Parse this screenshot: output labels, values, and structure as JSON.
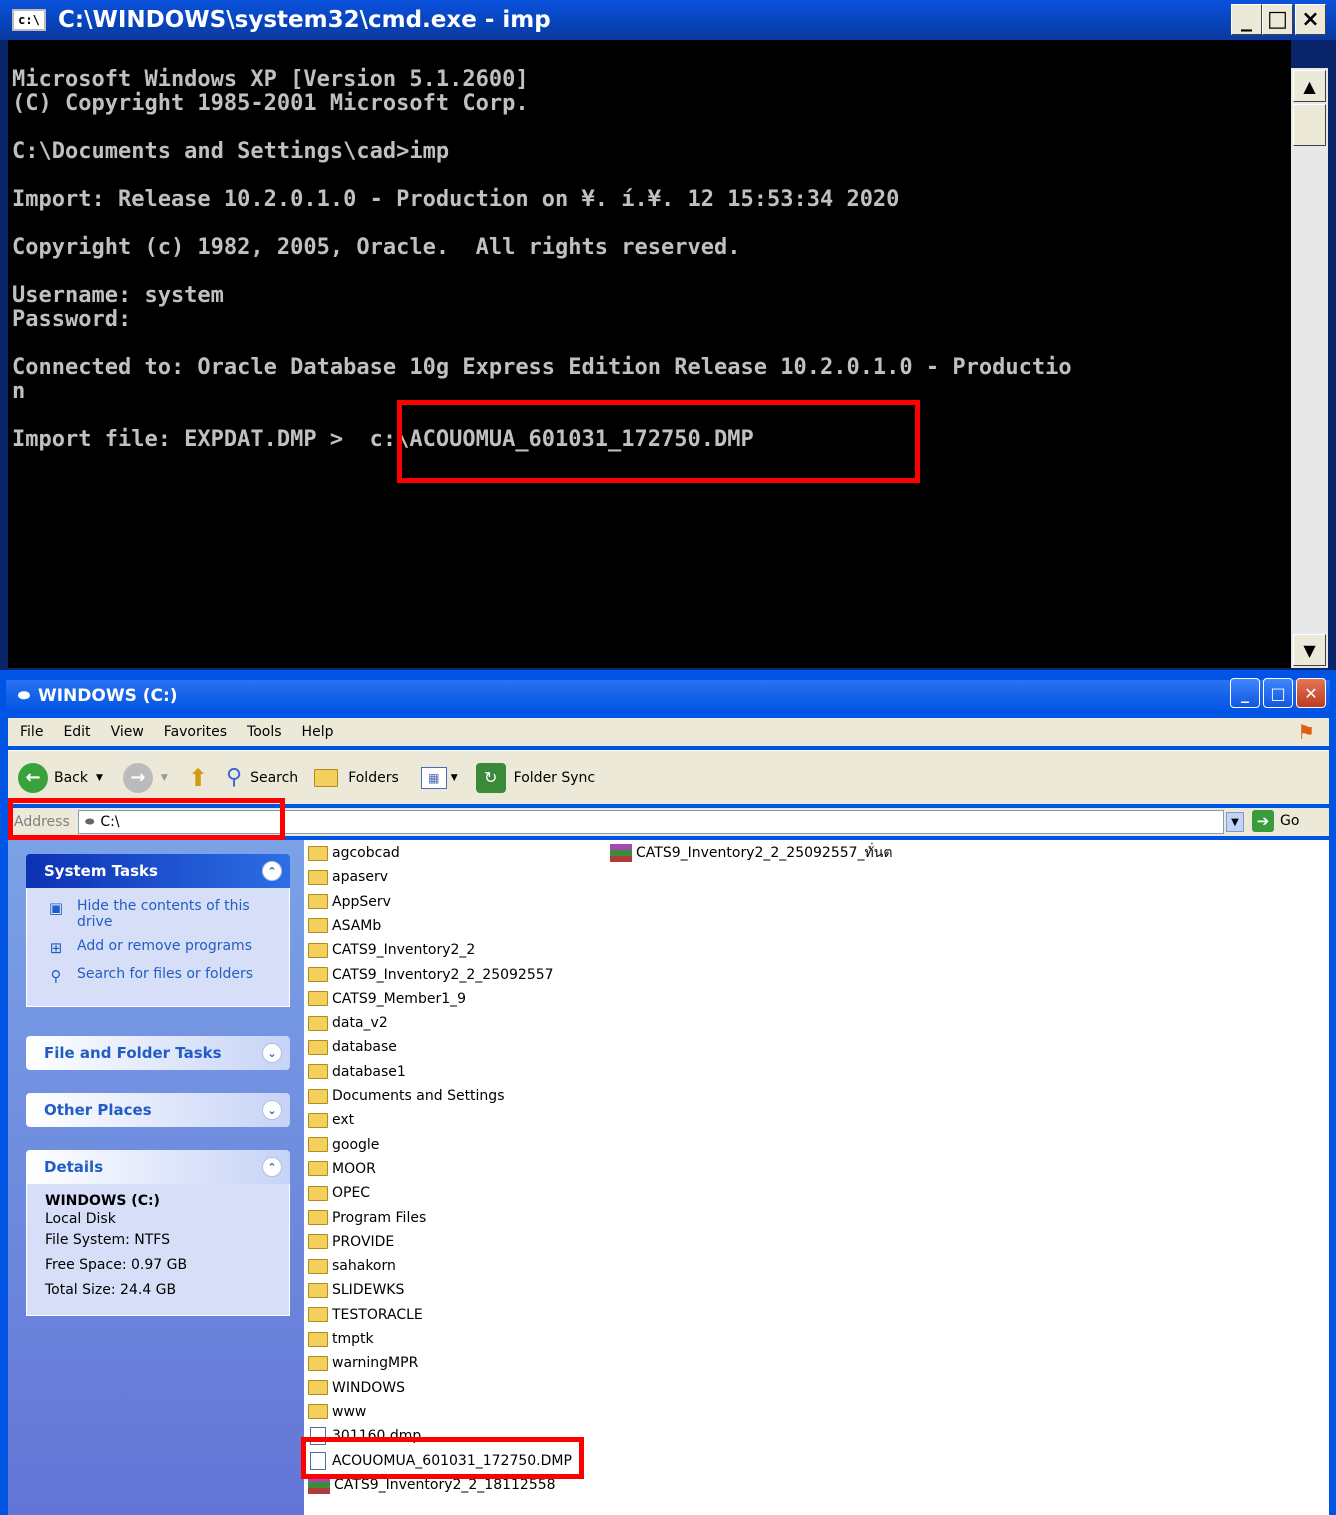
{
  "cmd": {
    "title": "C:\\WINDOWS\\system32\\cmd.exe - imp",
    "icon_text": "c:\\",
    "lines": [
      "Microsoft Windows XP [Version 5.1.2600]",
      "(C) Copyright 1985-2001 Microsoft Corp.",
      "",
      "C:\\Documents and Settings\\cad>imp",
      "",
      "Import: Release 10.2.0.1.0 - Production on ¥. í.¥. 12 15:53:34 2020",
      "",
      "Copyright (c) 1982, 2005, Oracle.  All rights reserved.",
      "",
      "Username: system",
      "Password:",
      "",
      "Connected to: Oracle Database 10g Express Edition Release 10.2.0.1.0 - Productio",
      "n",
      "",
      "Import file: EXPDAT.DMP >  c:\\ACOUOMUA_601031_172750.DMP"
    ],
    "window_buttons": [
      "_",
      "□",
      "×"
    ]
  },
  "explorer": {
    "title": "WINDOWS (C:)",
    "menu": [
      "File",
      "Edit",
      "View",
      "Favorites",
      "Tools",
      "Help"
    ],
    "toolbar": {
      "back": "Back",
      "search": "Search",
      "folders": "Folders",
      "folder_sync": "Folder Sync"
    },
    "address": {
      "label": "Address",
      "value": "C:\\",
      "go": "Go"
    },
    "system_tasks": {
      "title": "System Tasks",
      "items": [
        "Hide the contents of this drive",
        "Add or remove programs",
        "Search for files or folders"
      ]
    },
    "file_folder_tasks": {
      "title": "File and Folder Tasks"
    },
    "other_places": {
      "title": "Other Places"
    },
    "details": {
      "title": "Details",
      "name": "WINDOWS (C:)",
      "type": "Local Disk",
      "filesystem": "File System: NTFS",
      "free": "Free Space: 0.97 GB",
      "total": "Total Size: 24.4 GB"
    },
    "folders": [
      "agcobcad",
      "apaserv",
      "AppServ",
      "ASAMb",
      "CATS9_Inventory2_2",
      "CATS9_Inventory2_2_25092557",
      "CATS9_Member1_9",
      "data_v2",
      "database",
      "database1",
      "Documents and Settings",
      "ext",
      "google",
      "MOOR",
      "OPEC",
      "Program Files",
      "PROVIDE",
      "sahakorn",
      "SLIDEWKS",
      "TESTORACLE",
      "tmptk",
      "warningMPR",
      "WINDOWS",
      "www"
    ],
    "files": [
      "301160.dmp",
      "ACOUOMUA_601031_172750.DMP",
      "CATS9_Inventory2_2_18112558"
    ],
    "right_file": "CATS9_Inventory2_2_25092557_ทั่นต"
  }
}
